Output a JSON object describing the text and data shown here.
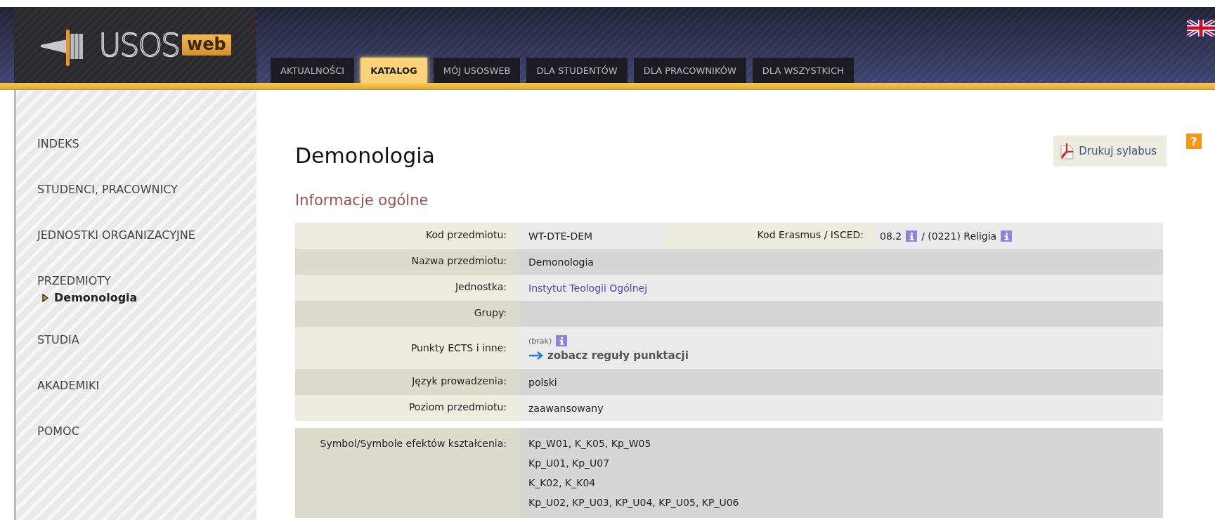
{
  "header": {
    "logo": {
      "name": "USOS",
      "badge": "web"
    },
    "tabs": [
      {
        "label": "AKTUALNOŚCI",
        "selected": false
      },
      {
        "label": "KATALOG",
        "selected": true
      },
      {
        "label": "MÓJ USOSWEB",
        "selected": false
      },
      {
        "label": "DLA STUDENTÓW",
        "selected": false
      },
      {
        "label": "DLA PRACOWNIKÓW",
        "selected": false
      },
      {
        "label": "DLA WSZYSTKICH",
        "selected": false
      }
    ]
  },
  "sidebar": {
    "items": [
      {
        "label": "INDEKS",
        "selected": false
      },
      {
        "label": "STUDENCI, PRACOWNICY",
        "selected": false
      },
      {
        "label": "JEDNOSTKI ORGANIZACYJNE",
        "selected": false
      },
      {
        "label": "PRZEDMIOTY",
        "selected": false,
        "children": [
          {
            "label": "Demonologia",
            "selected": true
          }
        ]
      },
      {
        "label": "STUDIA",
        "selected": false
      },
      {
        "label": "AKADEMIKI",
        "selected": false
      },
      {
        "label": "POMOC",
        "selected": false
      }
    ]
  },
  "content": {
    "title": "Demonologia",
    "print_button": "Drukuj sylabus",
    "help_button": "?",
    "section_heading": "Informacje ogólne",
    "table": {
      "rows": [
        {
          "kind": "pair",
          "label": "Kod przedmiotu:",
          "value": "WT-DTE-DEM",
          "label_2": "Kod Erasmus / ISCED:",
          "value_parts": [
            "08.2",
            "/ (0221) Religia"
          ]
        },
        {
          "kind": "text",
          "label": "Nazwa przedmiotu:",
          "value": "Demonologia"
        },
        {
          "kind": "link",
          "label": "Jednostka:",
          "value": "Instytut Teologii Ogólnej"
        },
        {
          "kind": "text",
          "label": "Grupy:"
        },
        {
          "kind": "ects",
          "label": "Punkty ECTS i inne:",
          "note": "(brak)",
          "link": "zobacz reguły punktacji"
        },
        {
          "kind": "text",
          "label": "Język prowadzenia:",
          "value": "polski"
        },
        {
          "kind": "text",
          "label": "Poziom przedmiotu:",
          "value": "zaawansowany"
        },
        {
          "kind": "lines",
          "label": "Symbol/Symbole efektów kształcenia:",
          "lines": [
            "Kp_W01, K_K05, Kp_W05",
            "Kp_U01, Kp_U07",
            "K_K02, K_K04",
            "Kp_U02, KP_U03, KP_U04, KP_U05, KP_U06"
          ]
        }
      ]
    }
  }
}
